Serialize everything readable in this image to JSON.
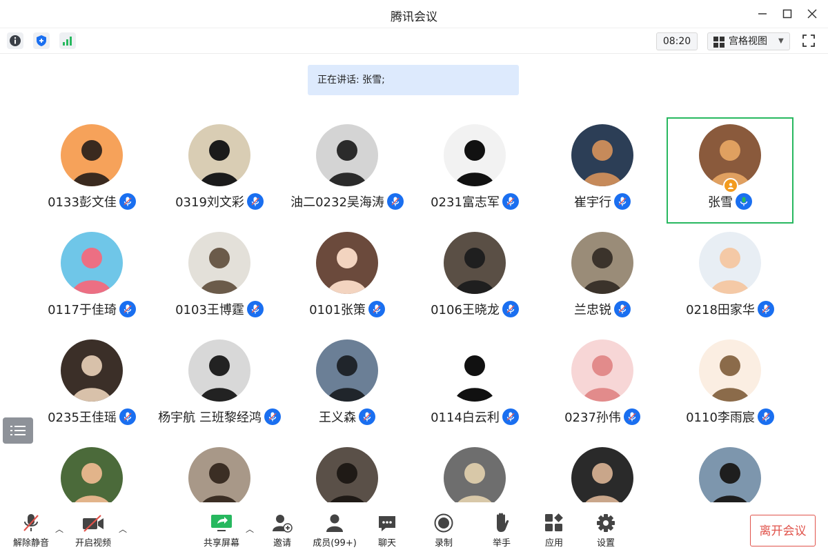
{
  "window": {
    "title": "腾讯会议"
  },
  "toolbar": {
    "time": "08:20",
    "view_label": "宫格视图"
  },
  "speaking": {
    "text": "正在讲话: 张雪;"
  },
  "participants": [
    {
      "name": "0133彭文佳",
      "bg": "#f6a25a",
      "fg": "#3a2a1f"
    },
    {
      "name": "0319刘文彩",
      "bg": "#d9cdb4",
      "fg": "#1b1b1b"
    },
    {
      "name": "油二0232吴海涛",
      "bg": "#d4d4d4",
      "fg": "#2b2b2b"
    },
    {
      "name": "0231富志军",
      "bg": "#f2f2f2",
      "fg": "#111111"
    },
    {
      "name": "崔宇行",
      "bg": "#2c3e56",
      "fg": "#c68a5a"
    },
    {
      "name": "张雪",
      "bg": "#8a5a3c",
      "fg": "#e0a060"
    },
    {
      "name": "0117于佳琦",
      "bg": "#6fc6e8",
      "fg": "#ec6f83"
    },
    {
      "name": "0103王博霆",
      "bg": "#e3e0d9",
      "fg": "#6b5b4a"
    },
    {
      "name": "0101张策",
      "bg": "#6b4a3c",
      "fg": "#f3d4c0"
    },
    {
      "name": "0106王晓龙",
      "bg": "#5a4f45",
      "fg": "#1f1f1f"
    },
    {
      "name": "兰忠锐",
      "bg": "#9a8c78",
      "fg": "#3b332b"
    },
    {
      "name": "0218田家华",
      "bg": "#e8eef4",
      "fg": "#f4c9a6"
    },
    {
      "name": "0235王佳瑶",
      "bg": "#3b2f28",
      "fg": "#d8c1aa"
    },
    {
      "name": "杨宇航 三班黎经鸿",
      "bg": "#d8d8d8",
      "fg": "#222222"
    },
    {
      "name": "王义森",
      "bg": "#6b7f96",
      "fg": "#20252b"
    },
    {
      "name": "0114白云利",
      "bg": "#ffffff",
      "fg": "#111111"
    },
    {
      "name": "0237孙伟",
      "bg": "#f7d6d6",
      "fg": "#e28b8b"
    },
    {
      "name": "0110李雨宸",
      "bg": "#fbeee2",
      "fg": "#8b6b4a"
    },
    {
      "name": "",
      "bg": "#4b6a3a",
      "fg": "#e2b48a"
    },
    {
      "name": "",
      "bg": "#a89888",
      "fg": "#3b2e24"
    },
    {
      "name": "",
      "bg": "#5a5048",
      "fg": "#1f1a16"
    },
    {
      "name": "",
      "bg": "#6e6e6e",
      "fg": "#d8c8a8"
    },
    {
      "name": "",
      "bg": "#2a2a2a",
      "fg": "#c9a68a"
    },
    {
      "name": "",
      "bg": "#7d96ad",
      "fg": "#1e1e1e"
    }
  ],
  "bottom": {
    "unmute": "解除静音",
    "video": "开启视频",
    "share": "共享屏幕",
    "invite": "邀请",
    "members": "成员(99+)",
    "chat": "聊天",
    "record": "录制",
    "raise": "举手",
    "apps": "应用",
    "settings": "设置",
    "leave": "离开会议"
  },
  "colors": {
    "accent": "#1a6ff0",
    "active_speaker": "#27b85f",
    "leave": "#e0524a",
    "speaking_bg": "#ddeafd"
  }
}
